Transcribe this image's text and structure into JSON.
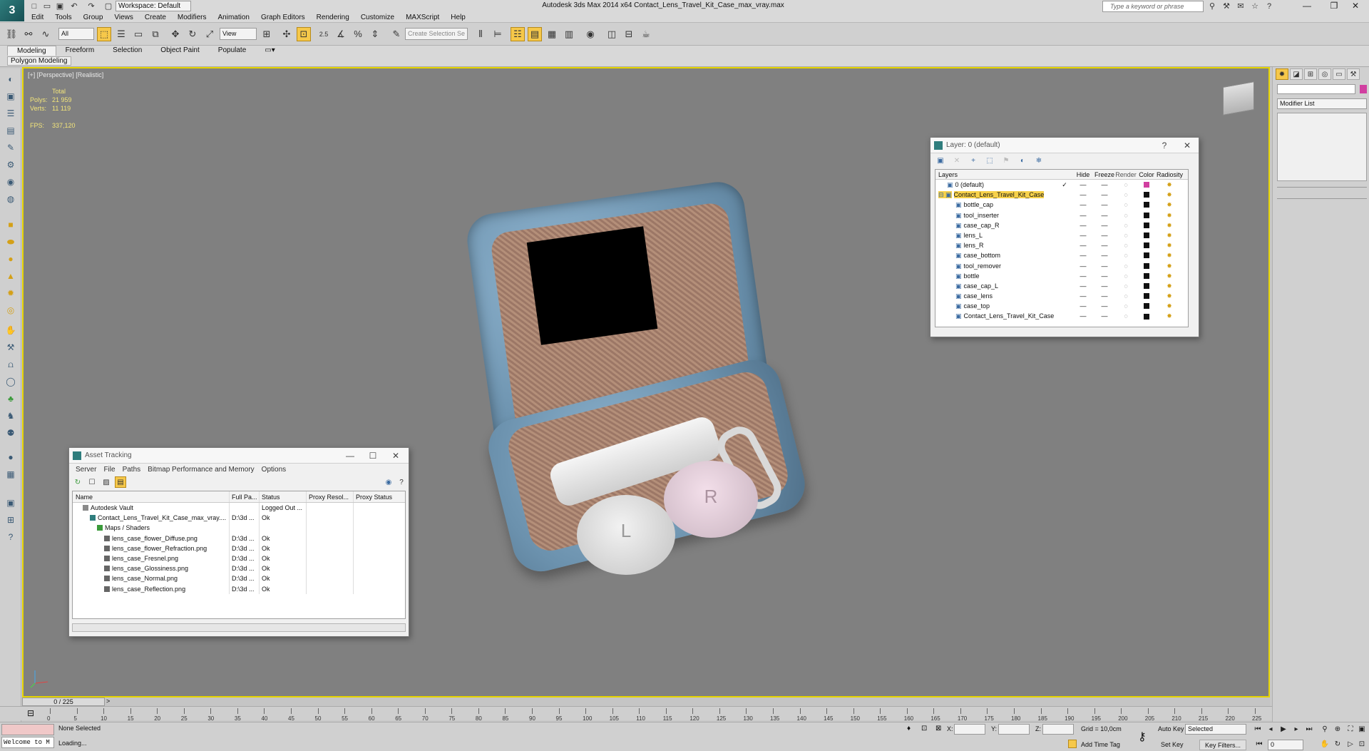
{
  "app": {
    "title": "Autodesk 3ds Max  2014 x64     Contact_Lens_Travel_Kit_Case_max_vray.max",
    "workspace": "Workspace: Default",
    "search_placeholder": "Type a keyword or phrase"
  },
  "menu": [
    "Edit",
    "Tools",
    "Group",
    "Views",
    "Create",
    "Modifiers",
    "Animation",
    "Graph Editors",
    "Rendering",
    "Customize",
    "MAXScript",
    "Help"
  ],
  "toolbar": {
    "filter_value": "All",
    "refcoord_value": "View",
    "snap_label": "2.5",
    "selection_set_placeholder": "Create Selection Se"
  },
  "ribbon": {
    "tabs": [
      "Modeling",
      "Freeform",
      "Selection",
      "Object Paint",
      "Populate"
    ],
    "active_tab": "Modeling",
    "sub_panel": "Polygon Modeling"
  },
  "viewport": {
    "label": "[+] [Perspective] [Realistic]",
    "stats": {
      "total_label": "Total",
      "polys_label": "Polys:",
      "polys_value": "21 959",
      "verts_label": "Verts:",
      "verts_value": "11 119",
      "fps_label": "FPS:",
      "fps_value": "337,120"
    },
    "cap_l_letter": "L",
    "cap_r_letter": "R"
  },
  "layer_dialog": {
    "title": "Layer: 0 (default)",
    "help": "?",
    "close": "✕",
    "columns": [
      "Layers",
      "Hide",
      "Freeze",
      "Render",
      "Color",
      "Radiosity"
    ],
    "rows": [
      {
        "name": "0 (default)",
        "check": "✓",
        "hide": "—",
        "freeze": "—",
        "render": "◌",
        "color": "#d13fa0",
        "radiosity": "✸",
        "indent": 1,
        "selected": false
      },
      {
        "name": "Contact_Lens_Travel_Kit_Case",
        "check": "",
        "hide": "—",
        "freeze": "—",
        "render": "◌",
        "color": "#111111",
        "radiosity": "✸",
        "indent": 0,
        "selected": true
      },
      {
        "name": "bottle_cap",
        "check": "",
        "hide": "—",
        "freeze": "—",
        "render": "◌",
        "color": "#111111",
        "radiosity": "✸",
        "indent": 2,
        "selected": false
      },
      {
        "name": "tool_inserter",
        "check": "",
        "hide": "—",
        "freeze": "—",
        "render": "◌",
        "color": "#111111",
        "radiosity": "✸",
        "indent": 2,
        "selected": false
      },
      {
        "name": "case_cap_R",
        "check": "",
        "hide": "—",
        "freeze": "—",
        "render": "◌",
        "color": "#111111",
        "radiosity": "✸",
        "indent": 2,
        "selected": false
      },
      {
        "name": "lens_L",
        "check": "",
        "hide": "—",
        "freeze": "—",
        "render": "◌",
        "color": "#111111",
        "radiosity": "✸",
        "indent": 2,
        "selected": false
      },
      {
        "name": "lens_R",
        "check": "",
        "hide": "—",
        "freeze": "—",
        "render": "◌",
        "color": "#111111",
        "radiosity": "✸",
        "indent": 2,
        "selected": false
      },
      {
        "name": "case_bottom",
        "check": "",
        "hide": "—",
        "freeze": "—",
        "render": "◌",
        "color": "#111111",
        "radiosity": "✸",
        "indent": 2,
        "selected": false
      },
      {
        "name": "tool_remover",
        "check": "",
        "hide": "—",
        "freeze": "—",
        "render": "◌",
        "color": "#111111",
        "radiosity": "✸",
        "indent": 2,
        "selected": false
      },
      {
        "name": "bottle",
        "check": "",
        "hide": "—",
        "freeze": "—",
        "render": "◌",
        "color": "#111111",
        "radiosity": "✸",
        "indent": 2,
        "selected": false
      },
      {
        "name": "case_cap_L",
        "check": "",
        "hide": "—",
        "freeze": "—",
        "render": "◌",
        "color": "#111111",
        "radiosity": "✸",
        "indent": 2,
        "selected": false
      },
      {
        "name": "case_lens",
        "check": "",
        "hide": "—",
        "freeze": "—",
        "render": "◌",
        "color": "#111111",
        "radiosity": "✸",
        "indent": 2,
        "selected": false
      },
      {
        "name": "case_top",
        "check": "",
        "hide": "—",
        "freeze": "—",
        "render": "◌",
        "color": "#111111",
        "radiosity": "✸",
        "indent": 2,
        "selected": false
      },
      {
        "name": "Contact_Lens_Travel_Kit_Case",
        "check": "",
        "hide": "—",
        "freeze": "—",
        "render": "◌",
        "color": "#111111",
        "radiosity": "✸",
        "indent": 2,
        "selected": false
      }
    ]
  },
  "asset_dialog": {
    "title": "Asset Tracking",
    "minimize": "—",
    "maximize": "☐",
    "close": "✕",
    "menu": [
      "Server",
      "File",
      "Paths",
      "Bitmap Performance and Memory",
      "Options"
    ],
    "columns": [
      "Name",
      "Full Pa...",
      "Status",
      "Proxy Resol...",
      "Proxy Status"
    ],
    "rows": [
      {
        "name": "Autodesk Vault",
        "path": "",
        "status": "Logged Out ...",
        "indent": 1,
        "icon_color": "#8a8a8a"
      },
      {
        "name": "Contact_Lens_Travel_Kit_Case_max_vray....",
        "path": "D:\\3d ...",
        "status": "Ok",
        "indent": 2,
        "icon_color": "#2f7d7d"
      },
      {
        "name": "Maps / Shaders",
        "path": "",
        "status": "",
        "indent": 3,
        "icon_color": "#3a9a3a"
      },
      {
        "name": "lens_case_flower_Diffuse.png",
        "path": "D:\\3d ...",
        "status": "Ok",
        "indent": 4,
        "icon_color": "#666666"
      },
      {
        "name": "lens_case_flower_Refraction.png",
        "path": "D:\\3d ...",
        "status": "Ok",
        "indent": 4,
        "icon_color": "#666666"
      },
      {
        "name": "lens_case_Fresnel.png",
        "path": "D:\\3d ...",
        "status": "Ok",
        "indent": 4,
        "icon_color": "#666666"
      },
      {
        "name": "lens_case_Glossiness.png",
        "path": "D:\\3d ...",
        "status": "Ok",
        "indent": 4,
        "icon_color": "#666666"
      },
      {
        "name": "lens_case_Normal.png",
        "path": "D:\\3d ...",
        "status": "Ok",
        "indent": 4,
        "icon_color": "#666666"
      },
      {
        "name": "lens_case_Reflection.png",
        "path": "D:\\3d ...",
        "status": "Ok",
        "indent": 4,
        "icon_color": "#666666"
      }
    ]
  },
  "command_panel": {
    "modifier_list": "Modifier List",
    "object_color": "#d13fa0"
  },
  "timeline": {
    "frame_counter": "0 / 225",
    "ticks": [
      "0",
      "5",
      "10",
      "15",
      "20",
      "25",
      "30",
      "35",
      "40",
      "45",
      "50",
      "55",
      "60",
      "65",
      "70",
      "75",
      "80",
      "85",
      "90",
      "95",
      "100",
      "105",
      "110",
      "115",
      "120",
      "125",
      "130",
      "135",
      "140",
      "145",
      "150",
      "155",
      "160",
      "165",
      "170",
      "175",
      "180",
      "185",
      "190",
      "195",
      "200",
      "205",
      "210",
      "215",
      "220",
      "225"
    ]
  },
  "statusbar": {
    "welcome": "Welcome to M",
    "selection": "None Selected",
    "prompt": "Loading...",
    "x_label": "X:",
    "y_label": "Y:",
    "z_label": "Z:",
    "grid": "Grid = 10,0cm",
    "add_time_tag": "Add Time Tag",
    "auto_key": "Auto Key",
    "set_key": "Set Key",
    "selected_value": "Selected",
    "key_filters": "Key Filters...",
    "frame_value": "0"
  }
}
